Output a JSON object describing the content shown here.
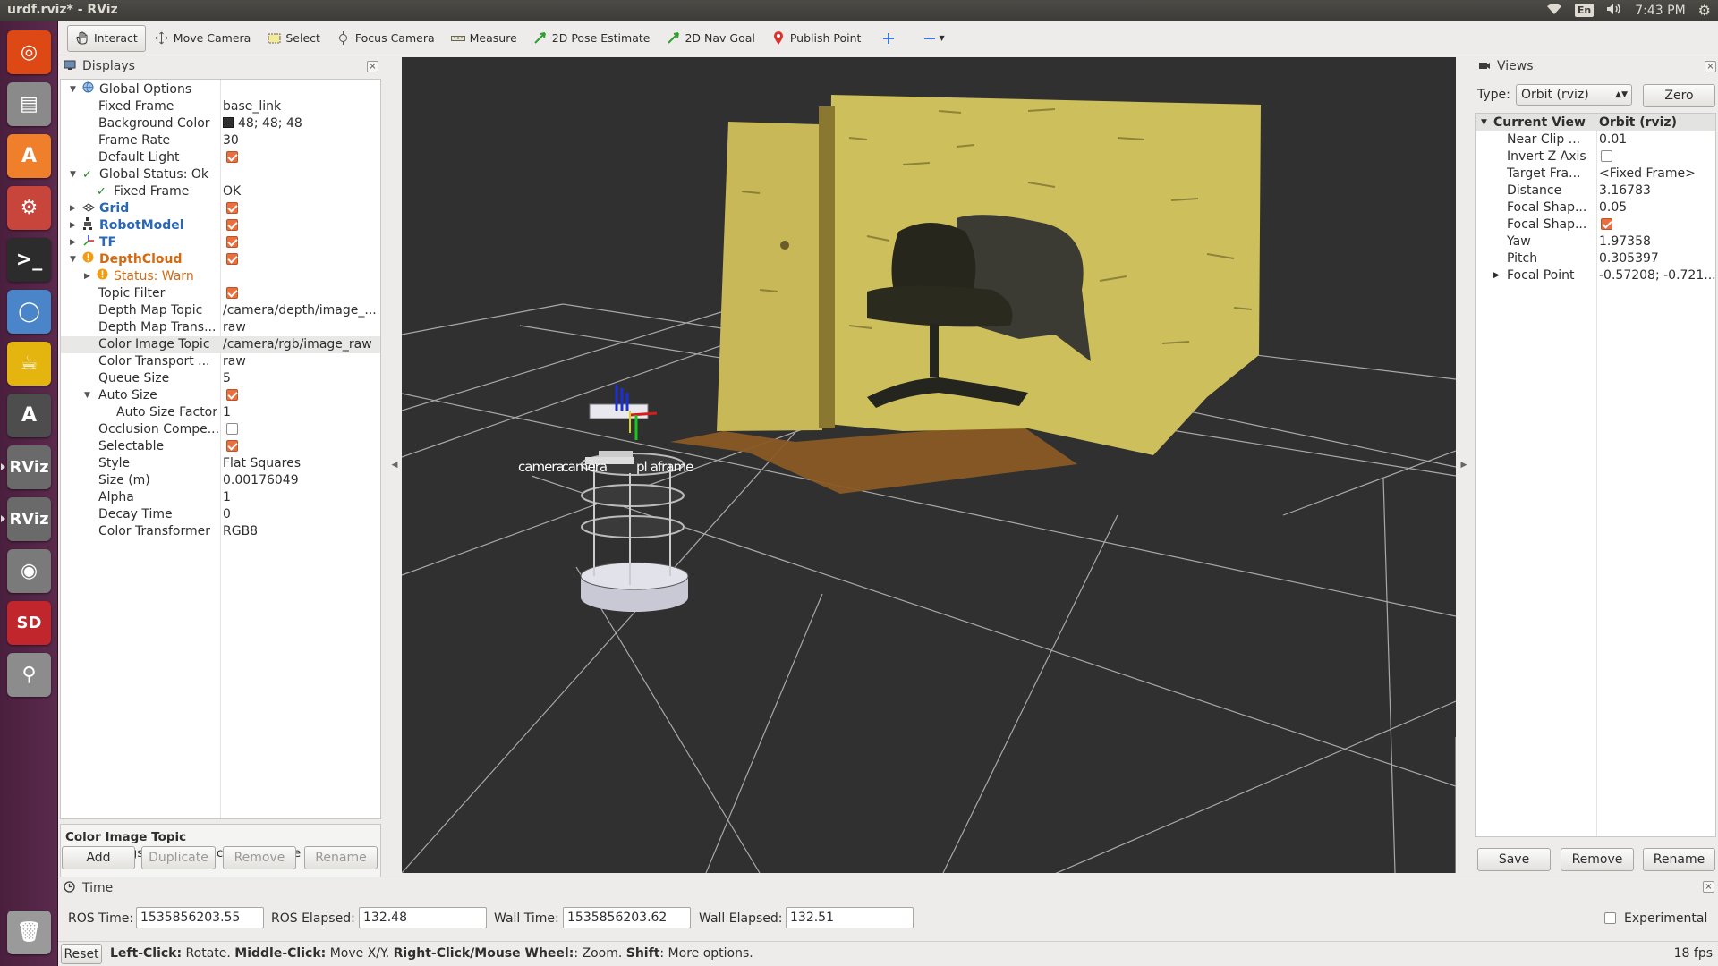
{
  "window": {
    "title": "urdf.rviz* - RViz"
  },
  "tray": {
    "lang": "En",
    "clock": "7:43 PM",
    "icons": [
      "wifi-icon",
      "volume-icon",
      "settings-gear-icon"
    ]
  },
  "launcher": {
    "items": [
      {
        "name": "ubuntu-dash-icon",
        "color": "#dd4814"
      },
      {
        "name": "files-icon",
        "color": "#8a8a8a"
      },
      {
        "name": "software-center-icon",
        "color": "#f07f2c"
      },
      {
        "name": "system-settings-icon",
        "color": "#c8453b"
      },
      {
        "name": "terminal-icon",
        "color": "#2c2c2c"
      },
      {
        "name": "chromium-icon",
        "color": "#4a84c9"
      },
      {
        "name": "teapot-icon",
        "color": "#e3b50e"
      },
      {
        "name": "software-updater-icon",
        "color": "#4d4d4d"
      },
      {
        "name": "rviz-icon",
        "color": "#6a6a6a",
        "label": "RViz"
      },
      {
        "name": "rviz-icon-2",
        "color": "#6a6a6a",
        "label": "RViz"
      },
      {
        "name": "camera-icon",
        "color": "#7a7a7a"
      },
      {
        "name": "sd-card-icon",
        "color": "#c0262b",
        "label": "SD"
      },
      {
        "name": "usb-drive-icon",
        "color": "#8c8c8c"
      },
      {
        "name": "trash-icon",
        "color": "#9a9a9a"
      }
    ]
  },
  "toolbar": {
    "tools": [
      {
        "label": "Interact",
        "icon": "hand-icon",
        "active": true
      },
      {
        "label": "Move Camera",
        "icon": "move-camera-icon"
      },
      {
        "label": "Select",
        "icon": "select-icon"
      },
      {
        "label": "Focus Camera",
        "icon": "focus-camera-icon"
      },
      {
        "label": "Measure",
        "icon": "measure-icon"
      },
      {
        "label": "2D Pose Estimate",
        "icon": "pose-estimate-icon"
      },
      {
        "label": "2D Nav Goal",
        "icon": "nav-goal-icon"
      },
      {
        "label": "Publish Point",
        "icon": "publish-point-icon"
      }
    ],
    "extra_icons": [
      "add-tool-icon",
      "remove-tool-icon"
    ]
  },
  "displays": {
    "title": "Displays",
    "rows": [
      {
        "indent": 0,
        "arrow": "down",
        "icon": "globe-icon",
        "name": "Global Options",
        "value": ""
      },
      {
        "indent": 1,
        "name": "Fixed Frame",
        "value": "base_link"
      },
      {
        "indent": 1,
        "name": "Background Color",
        "value": "48; 48; 48",
        "swatch": true
      },
      {
        "indent": 1,
        "name": "Frame Rate",
        "value": "30"
      },
      {
        "indent": 1,
        "name": "Default Light",
        "check": true
      },
      {
        "indent": 0,
        "arrow": "down",
        "icon": "ok-check-icon",
        "name": "Global Status: Ok",
        "value": ""
      },
      {
        "indent": 1,
        "icon": "ok-check-icon",
        "name": "Fixed Frame",
        "value": "OK"
      },
      {
        "indent": 0,
        "arrow": "right",
        "icon": "grid-icon",
        "name": "Grid",
        "style": "blue",
        "check": true
      },
      {
        "indent": 0,
        "arrow": "right",
        "icon": "robot-model-icon",
        "name": "RobotModel",
        "style": "blue",
        "check": true
      },
      {
        "indent": 0,
        "arrow": "right",
        "icon": "tf-icon",
        "name": "TF",
        "style": "blue",
        "check": true
      },
      {
        "indent": 0,
        "arrow": "down",
        "icon": "warning-icon",
        "name": "DepthCloud",
        "style": "orange",
        "check": true
      },
      {
        "indent": 1,
        "arrow": "right",
        "icon": "warning-icon",
        "name": "Status: Warn",
        "style": "warn",
        "value": ""
      },
      {
        "indent": 1,
        "name": "Topic Filter",
        "check": true
      },
      {
        "indent": 1,
        "name": "Depth Map Topic",
        "value": "/camera/depth/image_..."
      },
      {
        "indent": 1,
        "name": "Depth Map Trans...",
        "value": "raw"
      },
      {
        "indent": 1,
        "name": "Color Image Topic",
        "value": "/camera/rgb/image_raw",
        "selected": true
      },
      {
        "indent": 1,
        "name": "Color Transport ...",
        "value": "raw"
      },
      {
        "indent": 1,
        "name": "Queue Size",
        "value": "5"
      },
      {
        "indent": 1,
        "arrow": "down",
        "name": "Auto Size",
        "check": true
      },
      {
        "indent": 2,
        "name": "Auto Size Factor",
        "value": "1"
      },
      {
        "indent": 1,
        "name": "Occlusion Compe...",
        "check": false
      },
      {
        "indent": 1,
        "name": "Selectable",
        "check": true
      },
      {
        "indent": 1,
        "name": "Style",
        "value": "Flat Squares"
      },
      {
        "indent": 1,
        "name": "Size (m)",
        "value": "0.00176049"
      },
      {
        "indent": 1,
        "name": "Alpha",
        "value": "1"
      },
      {
        "indent": 1,
        "name": "Decay Time",
        "value": "0"
      },
      {
        "indent": 1,
        "name": "Color Transformer",
        "value": "RGB8"
      }
    ],
    "description": {
      "title": "Color Image Topic",
      "text": "sensor_msgs::Image topic to subscribe to."
    },
    "buttons": {
      "add": "Add",
      "duplicate": "Duplicate",
      "remove": "Remove",
      "rename": "Rename"
    }
  },
  "scene": {
    "tf_label": "camera...plate...",
    "tf_label_parts": [
      "ca",
      "camera",
      "base",
      "pl",
      "plate",
      "frame"
    ]
  },
  "views": {
    "title": "Views",
    "type_label": "Type:",
    "type_value": "Orbit (rviz)",
    "zero_button": "Zero",
    "header": {
      "name": "Current View",
      "value": "Orbit (rviz)"
    },
    "rows": [
      {
        "name": "Near Clip ...",
        "value": "0.01"
      },
      {
        "name": "Invert Z Axis",
        "check": false
      },
      {
        "name": "Target Fra...",
        "value": "<Fixed Frame>"
      },
      {
        "name": "Distance",
        "value": "3.16783"
      },
      {
        "name": "Focal Shap...",
        "value": "0.05"
      },
      {
        "name": "Focal Shap...",
        "check": true
      },
      {
        "name": "Yaw",
        "value": "1.97358"
      },
      {
        "name": "Pitch",
        "value": "0.305397"
      },
      {
        "name": "Focal Point",
        "value": "-0.57208; -0.721...",
        "arrow": "right"
      }
    ],
    "buttons": {
      "save": "Save",
      "remove": "Remove",
      "rename": "Rename"
    }
  },
  "time": {
    "title": "Time",
    "ros_time_label": "ROS Time:",
    "ros_time": "1535856203.55",
    "ros_elapsed_label": "ROS Elapsed:",
    "ros_elapsed": "132.48",
    "wall_time_label": "Wall Time:",
    "wall_time": "1535856203.62",
    "wall_elapsed_label": "Wall Elapsed:",
    "wall_elapsed": "132.51",
    "experimental_label": "Experimental"
  },
  "status": {
    "reset": "Reset",
    "hint_parts": [
      {
        "b": "Left-Click:",
        "t": " Rotate. "
      },
      {
        "b": "Middle-Click:",
        "t": " Move X/Y. "
      },
      {
        "b": "Right-Click/Mouse Wheel:",
        "t": ": Zoom. "
      },
      {
        "b": "Shift",
        "t": ": More options."
      }
    ],
    "fps": "18 fps"
  }
}
